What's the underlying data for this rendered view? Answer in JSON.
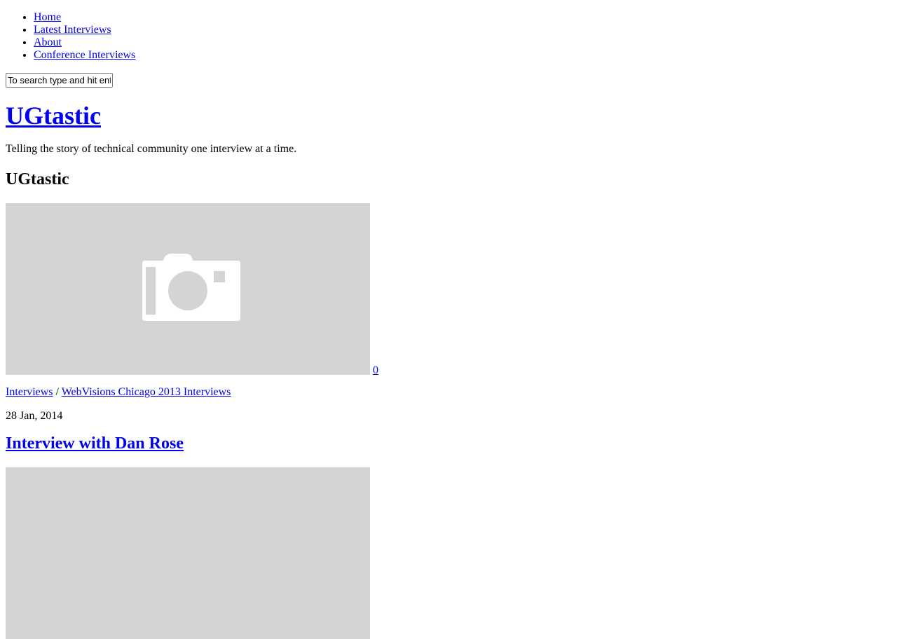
{
  "nav": {
    "items": [
      "Home",
      "Latest Interviews",
      "About",
      "Conference Interviews"
    ]
  },
  "search": {
    "placeholder": "To search type and hit enter"
  },
  "site": {
    "title": "UGtastic",
    "tagline": "Telling the story of technical community one interview at a time."
  },
  "section": {
    "title": "UGtastic"
  },
  "post": {
    "comment_count": "0",
    "category_1": "Interviews",
    "separator": " / ",
    "category_2": "WebVisions Chicago 2013 Interviews",
    "date": "28 Jan, 2014",
    "title": "Interview with Dan Rose"
  },
  "icons": {
    "thumbnail_placeholder": "camera-icon"
  },
  "colors": {
    "link": "#0000ee",
    "placeholder_bg": "#d4d4d4"
  }
}
